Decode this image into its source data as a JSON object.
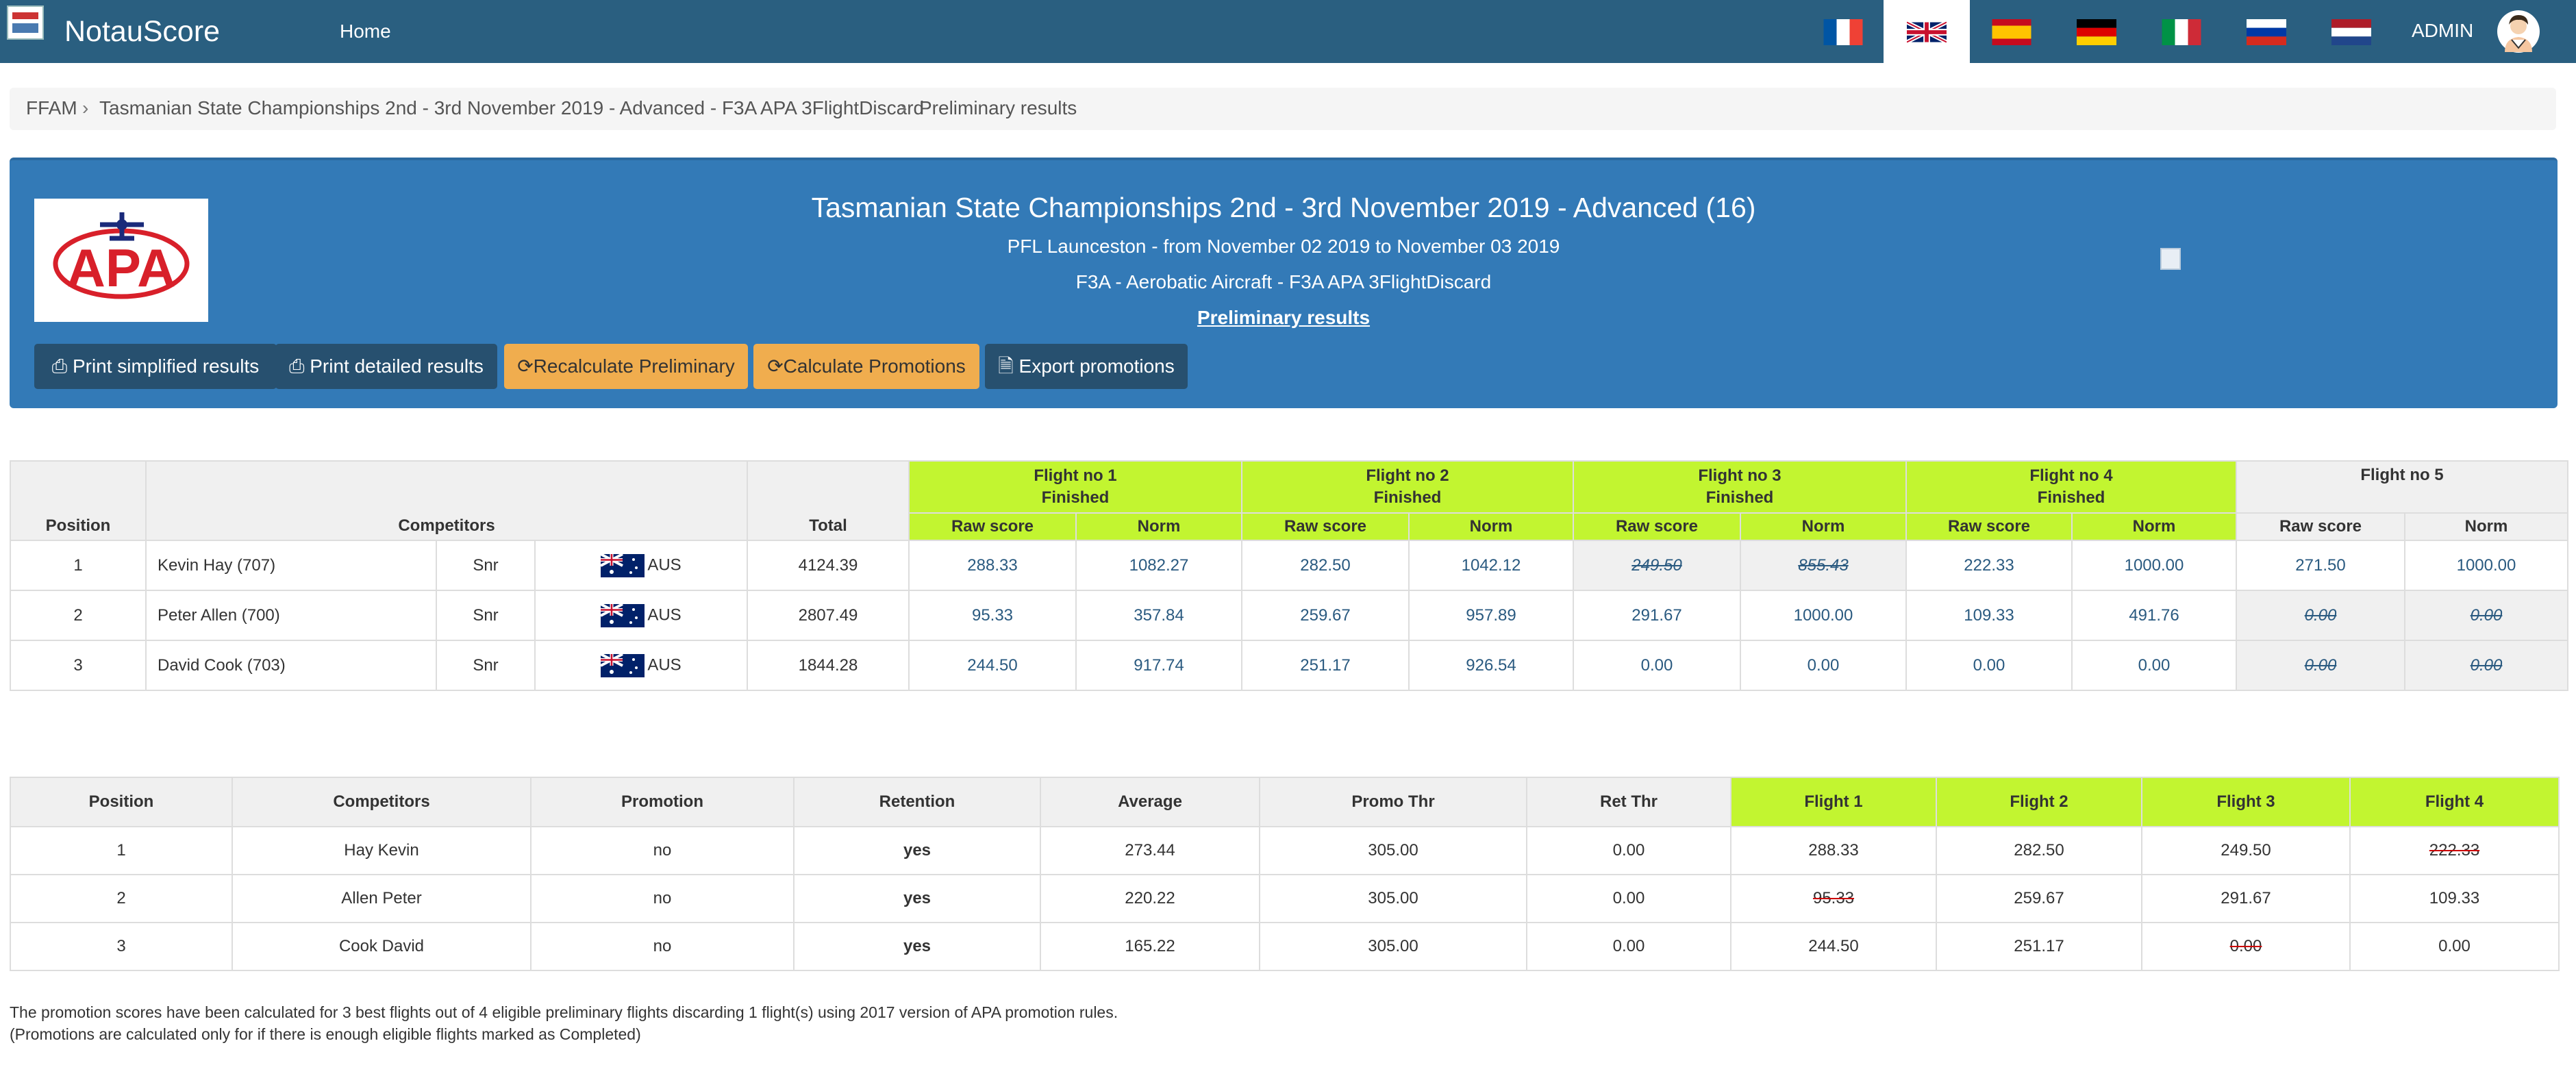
{
  "navbar": {
    "brand": "NotauScore",
    "home": "Home",
    "admin": "ADMIN",
    "flags": [
      "france-flag-icon",
      "uk-flag-icon",
      "spain-flag-icon",
      "germany-flag-icon",
      "italy-flag-icon",
      "russia-flag-icon",
      "netherlands-flag-icon"
    ],
    "active_flag": "uk-flag-icon"
  },
  "breadcrumb": {
    "items": [
      "FFAM",
      "Tasmanian State Championships 2nd - 3rd November 2019 - Advanced - F3A APA 3FlightDiscard",
      "Preliminary results"
    ],
    "separator": "›"
  },
  "panel": {
    "title": "Tasmanian State Championships 2nd - 3rd November 2019 - Advanced (16)",
    "location": "PFL Launceston - from November 02 2019 to November 03 2019",
    "category": "F3A - Aerobatic Aircraft - F3A APA 3FlightDiscard",
    "results_link": "Preliminary results",
    "logo_text": "APA",
    "buttons": {
      "print_simplified": "Print simplified results",
      "print_detailed": "Print detailed results",
      "recalculate": "Recalculate Preliminary",
      "calc_promotions": "Calculate Promotions",
      "export_promotions": "Export promotions"
    }
  },
  "results": {
    "headers": {
      "position": "Position",
      "competitors": "Competitors",
      "total": "Total",
      "raw": "Raw score",
      "norm": "Norm"
    },
    "flights": [
      {
        "name": "Flight no 1",
        "status": "Finished"
      },
      {
        "name": "Flight no 2",
        "status": "Finished"
      },
      {
        "name": "Flight no 3",
        "status": "Finished"
      },
      {
        "name": "Flight no 4",
        "status": "Finished"
      },
      {
        "name": "Flight no 5",
        "status": ""
      }
    ],
    "rows": [
      {
        "position": "1",
        "name": "Kevin Hay (707)",
        "class": "Snr",
        "country": "AUS",
        "total": "4124.39",
        "scores": [
          "288.33",
          "1082.27",
          "282.50",
          "1042.12",
          "249.50",
          "855.43",
          "222.33",
          "1000.00",
          "271.50",
          "1000.00"
        ]
      },
      {
        "position": "2",
        "name": "Peter Allen (700)",
        "class": "Snr",
        "country": "AUS",
        "total": "2807.49",
        "scores": [
          "95.33",
          "357.84",
          "259.67",
          "957.89",
          "291.67",
          "1000.00",
          "109.33",
          "491.76",
          "0.00",
          "0.00"
        ]
      },
      {
        "position": "3",
        "name": "David Cook (703)",
        "class": "Snr",
        "country": "AUS",
        "total": "1844.28",
        "scores": [
          "244.50",
          "917.74",
          "251.17",
          "926.54",
          "0.00",
          "0.00",
          "0.00",
          "0.00",
          "0.00",
          "0.00"
        ]
      }
    ]
  },
  "promotions": {
    "headers": [
      "Position",
      "Competitors",
      "Promotion",
      "Retention",
      "Average",
      "Promo Thr",
      "Ret Thr",
      "Flight 1",
      "Flight 2",
      "Flight 3",
      "Flight 4"
    ],
    "rows": [
      [
        "1",
        "Hay Kevin",
        "no",
        "yes",
        "273.44",
        "305.00",
        "0.00",
        "288.33",
        "282.50",
        "249.50",
        "222.33"
      ],
      [
        "2",
        "Allen Peter",
        "no",
        "yes",
        "220.22",
        "305.00",
        "0.00",
        "95.33",
        "259.67",
        "291.67",
        "109.33"
      ],
      [
        "3",
        "Cook David",
        "no",
        "yes",
        "165.22",
        "305.00",
        "0.00",
        "244.50",
        "251.17",
        "0.00",
        "0.00"
      ]
    ]
  },
  "footnotes": [
    "The promotion scores have been calculated for 3 best flights out of 4 eligible preliminary flights discarding 1 flight(s) using 2017 version of APA promotion rules.",
    "(Promotions are calculated only for if there is enough eligible flights marked as Completed)"
  ],
  "colors": {
    "navbar": "#2a5f80",
    "panel": "#337ab7",
    "lime": "#c2f530",
    "orange": "#f0ad4e"
  }
}
